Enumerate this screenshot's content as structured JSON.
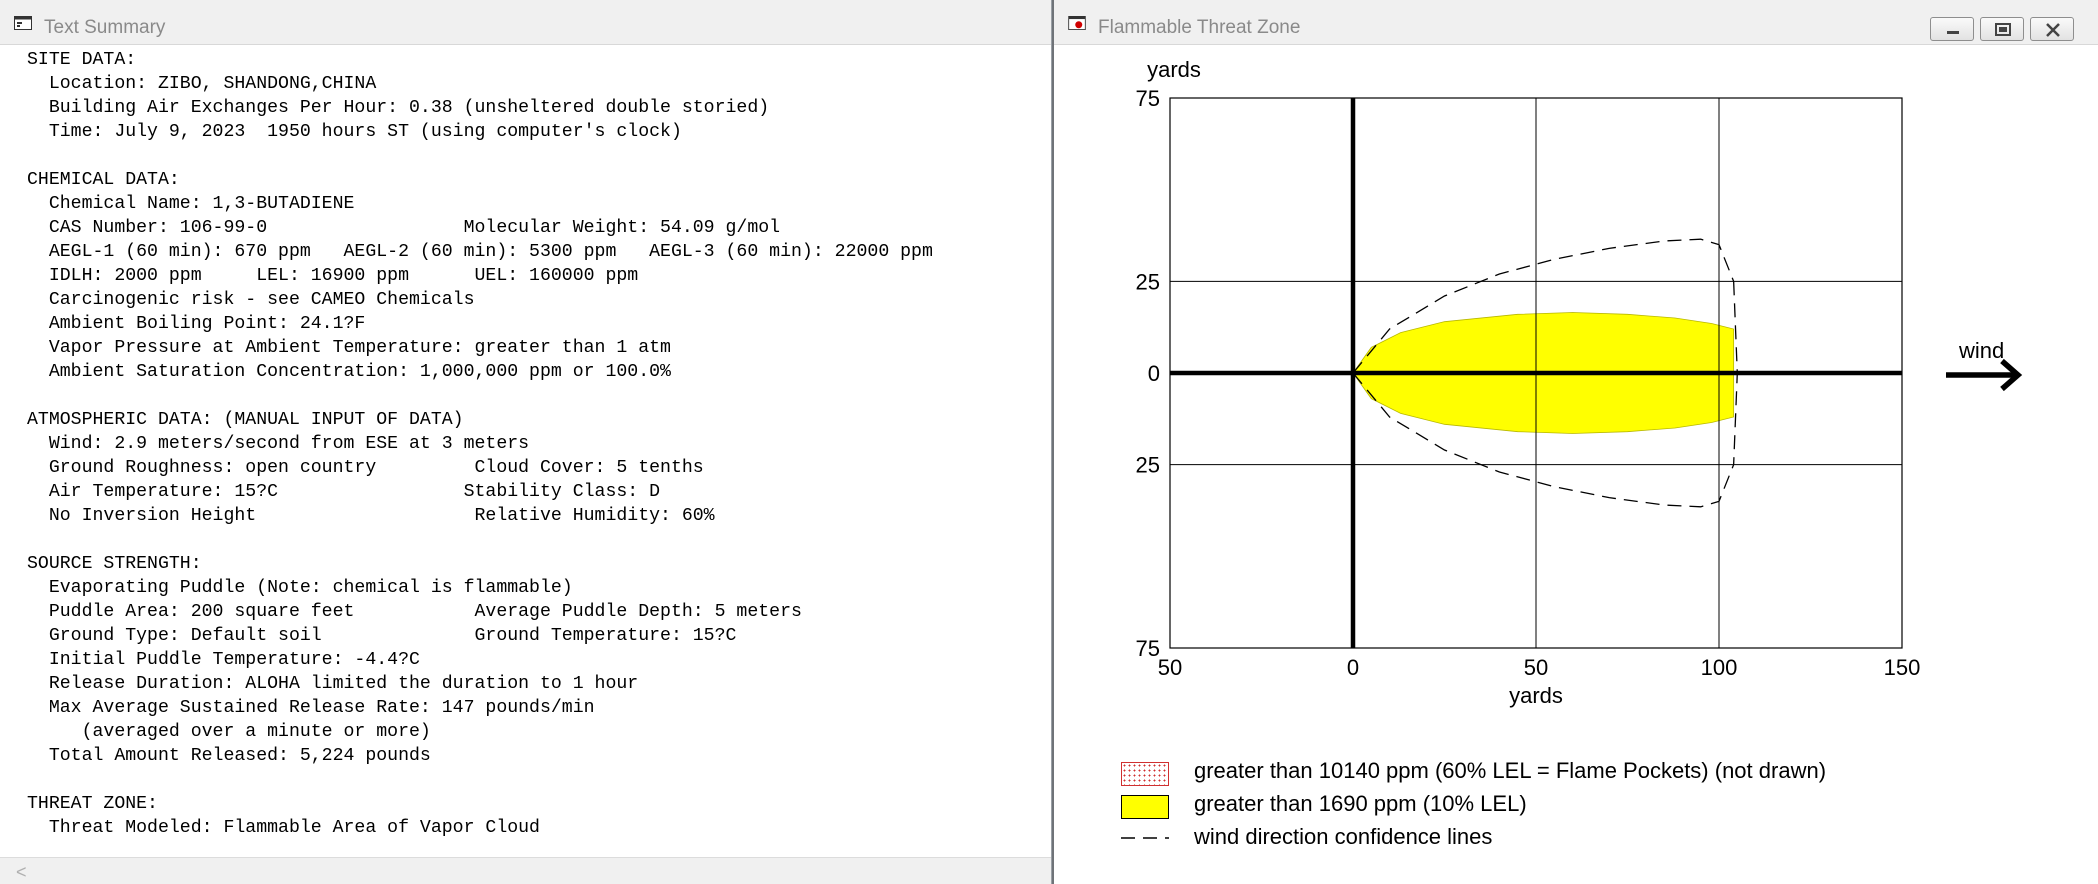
{
  "summary_window": {
    "title": "Text Summary",
    "lines": [
      "SITE DATA:",
      "  Location: ZIBO, SHANDONG,CHINA",
      "  Building Air Exchanges Per Hour: 0.38 (unsheltered double storied)",
      "  Time: July 9, 2023  1950 hours ST (using computer's clock)",
      "",
      "CHEMICAL DATA:",
      "  Chemical Name: 1,3-BUTADIENE",
      "  CAS Number: 106-99-0                  Molecular Weight: 54.09 g/mol",
      "  AEGL-1 (60 min): 670 ppm   AEGL-2 (60 min): 5300 ppm   AEGL-3 (60 min): 22000 ppm",
      "  IDLH: 2000 ppm     LEL: 16900 ppm      UEL: 160000 ppm",
      "  Carcinogenic risk - see CAMEO Chemicals",
      "  Ambient Boiling Point: 24.1?F",
      "  Vapor Pressure at Ambient Temperature: greater than 1 atm",
      "  Ambient Saturation Concentration: 1,000,000 ppm or 100.0%",
      "",
      "ATMOSPHERIC DATA: (MANUAL INPUT OF DATA)",
      "  Wind: 2.9 meters/second from ESE at 3 meters",
      "  Ground Roughness: open country         Cloud Cover: 5 tenths",
      "  Air Temperature: 15?C                 Stability Class: D",
      "  No Inversion Height                    Relative Humidity: 60%",
      "",
      "SOURCE STRENGTH:",
      "  Evaporating Puddle (Note: chemical is flammable)",
      "  Puddle Area: 200 square feet           Average Puddle Depth: 5 meters",
      "  Ground Type: Default soil              Ground Temperature: 15?C",
      "  Initial Puddle Temperature: -4.4?C",
      "  Release Duration: ALOHA limited the duration to 1 hour",
      "  Max Average Sustained Release Rate: 147 pounds/min",
      "     (averaged over a minute or more)",
      "  Total Amount Released: 5,224 pounds",
      "",
      "THREAT ZONE:",
      "  Threat Modeled: Flammable Area of Vapor Cloud"
    ],
    "scroll_left_glyph": "<"
  },
  "threat_window": {
    "title": "Flammable Threat Zone",
    "wind_label": "wind",
    "legend": [
      {
        "label": "greater than 10140 ppm (60% LEL = Flame Pockets) (not drawn)",
        "swatch": "dotted-red"
      },
      {
        "label": "greater than 1690 ppm (10% LEL)",
        "swatch": "yellow"
      },
      {
        "label": "wind direction confidence lines",
        "swatch": "dashed"
      }
    ]
  },
  "chart_data": {
    "type": "area",
    "xlabel": "yards",
    "ylabel": "yards",
    "xlim": [
      -50,
      150
    ],
    "ylim": [
      -75,
      75
    ],
    "x_tick_labels": [
      "50",
      "0",
      "50",
      "100",
      "150"
    ],
    "x_ticks": [
      -50,
      0,
      50,
      100,
      150
    ],
    "y_tick_labels": [
      "75",
      "25",
      "0",
      "25",
      "75"
    ],
    "y_ticks": [
      75,
      25,
      0,
      -25,
      -75
    ],
    "grid": true,
    "colors": {
      "zone": "#ffff00",
      "axis": "#000000",
      "grid": "#000000"
    },
    "series": [
      {
        "kind": "zone-fill",
        "x": [
          0,
          5,
          13,
          25,
          45,
          60,
          75,
          88,
          98,
          104,
          104,
          98,
          88,
          75,
          60,
          45,
          25,
          13,
          5,
          0
        ],
        "y": [
          0,
          7,
          11,
          14,
          16,
          16.5,
          16,
          15,
          13.5,
          12,
          -12,
          -13.5,
          -15,
          -16,
          -16.5,
          -16,
          -14,
          -11,
          -7,
          0
        ]
      },
      {
        "kind": "confidence-upper",
        "x": [
          0,
          10,
          25,
          40,
          55,
          70,
          85,
          95,
          100,
          104
        ],
        "y": [
          0,
          12,
          21,
          27,
          31,
          34,
          36,
          36.5,
          35,
          25
        ]
      },
      {
        "kind": "confidence-lower",
        "x": [
          0,
          10,
          25,
          40,
          55,
          70,
          85,
          95,
          100,
          104
        ],
        "y": [
          0,
          -12,
          -21,
          -27,
          -31,
          -34,
          -36,
          -36.5,
          -35,
          -25
        ]
      },
      {
        "kind": "confidence-tip",
        "x": [
          104,
          105,
          104
        ],
        "y": [
          25,
          0,
          -25
        ]
      }
    ]
  }
}
